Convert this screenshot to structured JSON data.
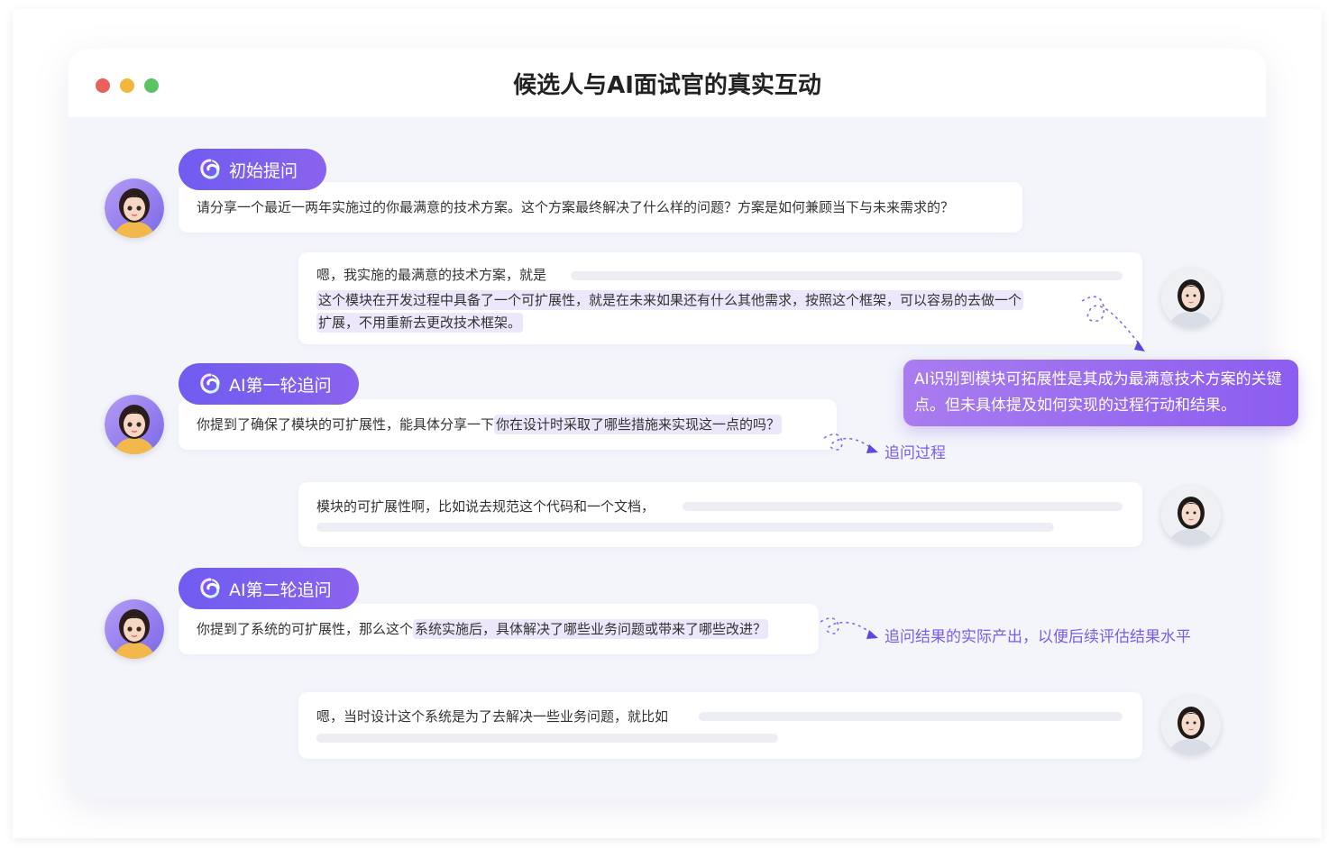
{
  "window": {
    "title": "候选人与AI面试官的真实互动"
  },
  "icons": {
    "interviewer_avatar": "cartoon-girl-avatar-icon",
    "candidate_avatar": "woman-photo-avatar-icon",
    "ai_badge": "ai-swirl-icon"
  },
  "colors": {
    "accent": "#7b5cf0",
    "pill_gradient_start": "#6f5cf0",
    "pill_gradient_end": "#8a63ee",
    "highlight": "#ece7fb"
  },
  "conversation": {
    "q1": {
      "tag": "初始提问",
      "text": "请分享一个最近一两年实施过的你最满意的技术方案。这个方案最终解决了什么样的问题？方案是如何兼顾当下与未来需求的？"
    },
    "a1": {
      "line1": "嗯，我实施的最满意的技术方案，就是",
      "line2": "这个模块在开发过程中具备了一个可扩展性，就是在未来如果还有什么其他需求，按照这个框架，可以容易的去做一个",
      "line3": "扩展，不用重新去更改技术框架。"
    },
    "annotation1": "AI识别到模块可拓展性是其成为最满意技术方案的关键点。但未具体提及如何实现的过程行动和结果。",
    "q2": {
      "tag": "AI第一轮追问",
      "prefix": "你提到了确保了模块的可扩展性，能具体分享一下",
      "highlight": "你在设计时采取了哪些措施来实现这一点的吗？"
    },
    "annotation2": "追问过程",
    "a2": {
      "line1": "模块的可扩展性啊，比如说去规范这个代码和一个文档，"
    },
    "q3": {
      "tag": "AI第二轮追问",
      "prefix": "你提到了系统的可扩展性，那么这个",
      "highlight": "系统实施后，具体解决了哪些业务问题或带来了哪些改进？"
    },
    "annotation3": "追问结果的实际产出，以便后续评估结果水平",
    "a3": {
      "line1": "嗯，当时设计这个系统是为了去解决一些业务问题，就比如"
    }
  }
}
